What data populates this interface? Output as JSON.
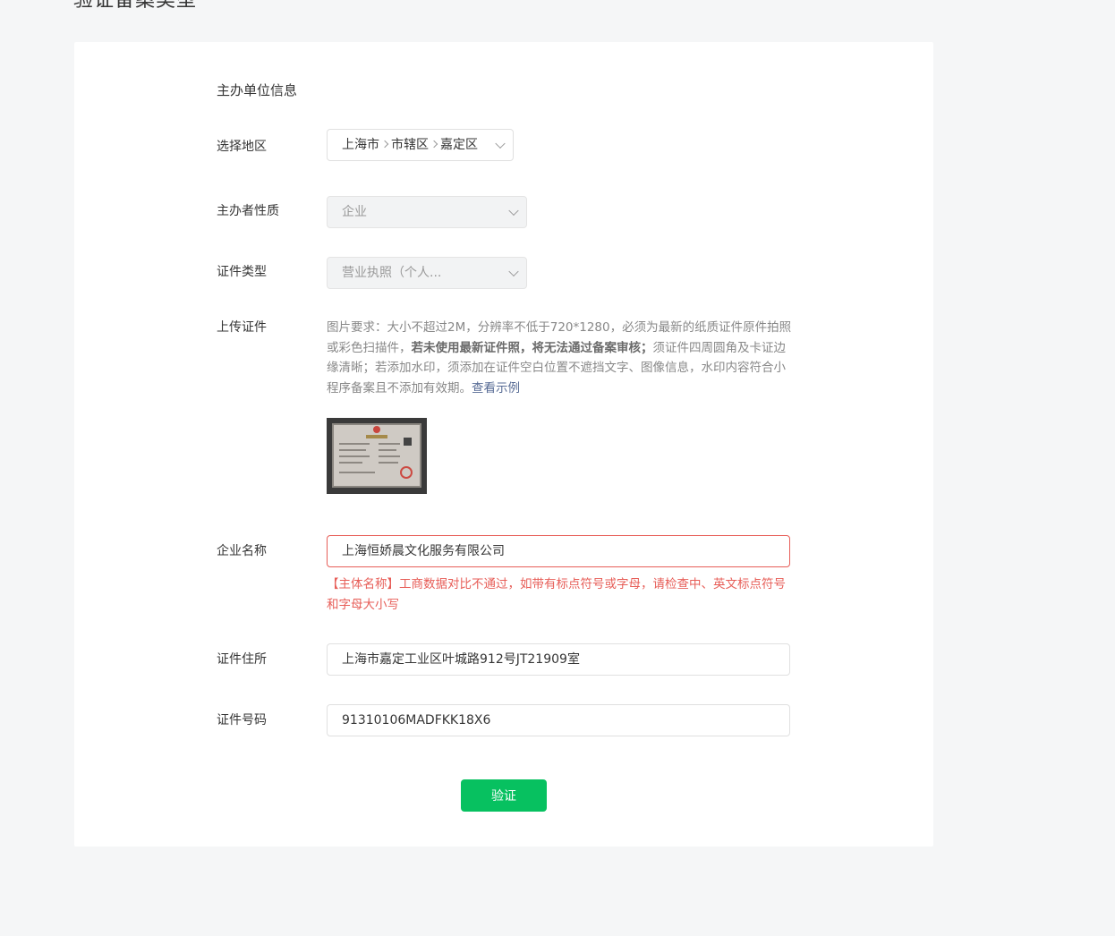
{
  "page": {
    "title": "验证备案类型"
  },
  "section": {
    "title": "主办单位信息"
  },
  "region": {
    "label": "选择地区",
    "province": "上海市",
    "city": "市辖区",
    "district": "嘉定区"
  },
  "nature": {
    "label": "主办者性质",
    "value": "企业"
  },
  "cert_type": {
    "label": "证件类型",
    "value": "营业执照（个人..."
  },
  "upload": {
    "label": "上传证件",
    "desc_part1": "图片要求：大小不超过2M，分辨率不低于720*1280，必须为最新的纸质证件原件拍照或彩色扫描件，",
    "desc_bold": "若未使用最新证件照，将无法通过备案审核；",
    "desc_part2": "须证件四周圆角及卡证边缘清晰；若添加水印，须添加在证件空白位置不遮挡文字、图像信息，水印内容符合小程序备案且不添加有效期。",
    "example_link": "查看示例"
  },
  "company": {
    "label": "企业名称",
    "value": "上海恒娇晨文化服务有限公司",
    "error": "【主体名称】工商数据对比不通过，如带有标点符号或字母，请检查中、英文标点符号和字母大小写"
  },
  "address": {
    "label": "证件住所",
    "value": "上海市嘉定工业区叶城路912号JT21909室"
  },
  "cert_no": {
    "label": "证件号码",
    "value": "91310106MADFKK18X6"
  },
  "submit": {
    "label": "验证"
  },
  "colors": {
    "accent": "#07c160",
    "error": "#e75e58",
    "link": "#576b95"
  }
}
